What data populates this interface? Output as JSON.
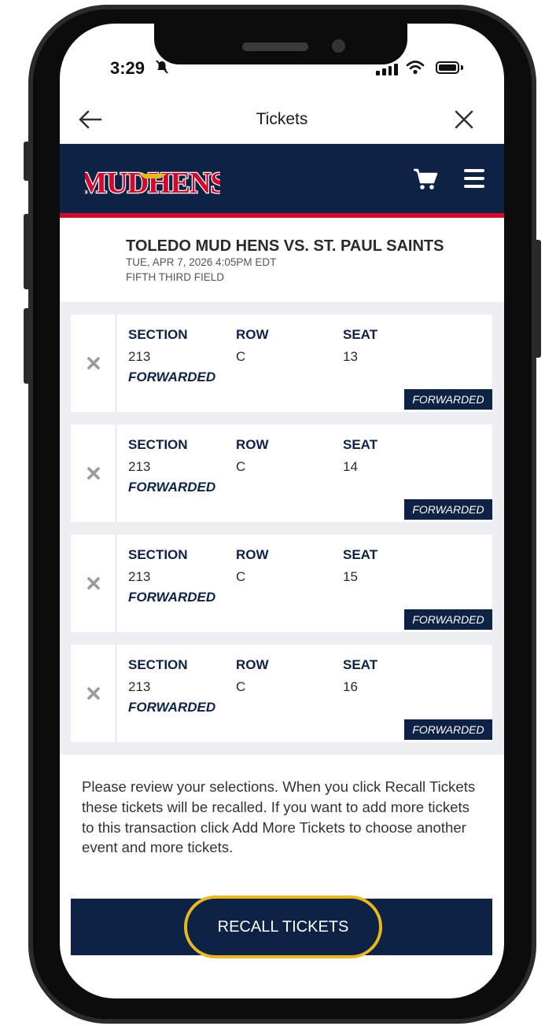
{
  "status_bar": {
    "time": "3:29"
  },
  "nav": {
    "title": "Tickets"
  },
  "brand": {
    "logo_text": "MUDHENS",
    "primary_color": "#0e2245",
    "accent_color": "#cf0a2c",
    "highlight_color": "#e8b820"
  },
  "event": {
    "name": "TOLEDO MUD HENS VS. ST. PAUL SAINTS",
    "datetime": "TUE, APR 7, 2026 4:05PM EDT",
    "venue": "FIFTH THIRD FIELD"
  },
  "ticket_columns": {
    "section": "SECTION",
    "row": "ROW",
    "seat": "SEAT"
  },
  "tickets": [
    {
      "section": "213",
      "row": "C",
      "seat": "13",
      "status": "FORWARDED",
      "badge": "FORWARDED"
    },
    {
      "section": "213",
      "row": "C",
      "seat": "14",
      "status": "FORWARDED",
      "badge": "FORWARDED"
    },
    {
      "section": "213",
      "row": "C",
      "seat": "15",
      "status": "FORWARDED",
      "badge": "FORWARDED"
    },
    {
      "section": "213",
      "row": "C",
      "seat": "16",
      "status": "FORWARDED",
      "badge": "FORWARDED"
    }
  ],
  "instructions": "Please review your selections. When you click Recall Tickets these tickets will be recalled. If you want to add more tickets to this transaction click Add More Tickets to choose another event and more tickets.",
  "actions": {
    "recall_label": "RECALL TICKETS"
  }
}
